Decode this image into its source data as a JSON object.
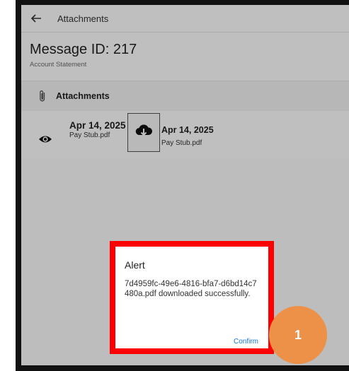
{
  "topbar": {
    "title": "Attachments",
    "back_icon": "back-arrow-icon"
  },
  "message": {
    "title": "Message ID: 217",
    "subtitle": "Account Statement"
  },
  "section": {
    "title": "Attachments",
    "icon": "paperclip-icon"
  },
  "attachments": [
    {
      "date": "Apr 14, 2025",
      "file": "Pay Stub.pdf",
      "icon": "eye-icon"
    },
    {
      "date": "Apr 14, 2025",
      "file": "Pay Stub.pdf",
      "icon": "cloud-download-icon"
    }
  ],
  "dialog": {
    "title": "Alert",
    "message": "7d4959fc-49e6-4816-bfa7-d6bd14c7480a.pdf downloaded successfully.",
    "confirm_label": "Confirm"
  },
  "step_badge": "1",
  "colors": {
    "highlight": "#ff0000",
    "badge": "#ec9147",
    "link": "#1976d2"
  }
}
